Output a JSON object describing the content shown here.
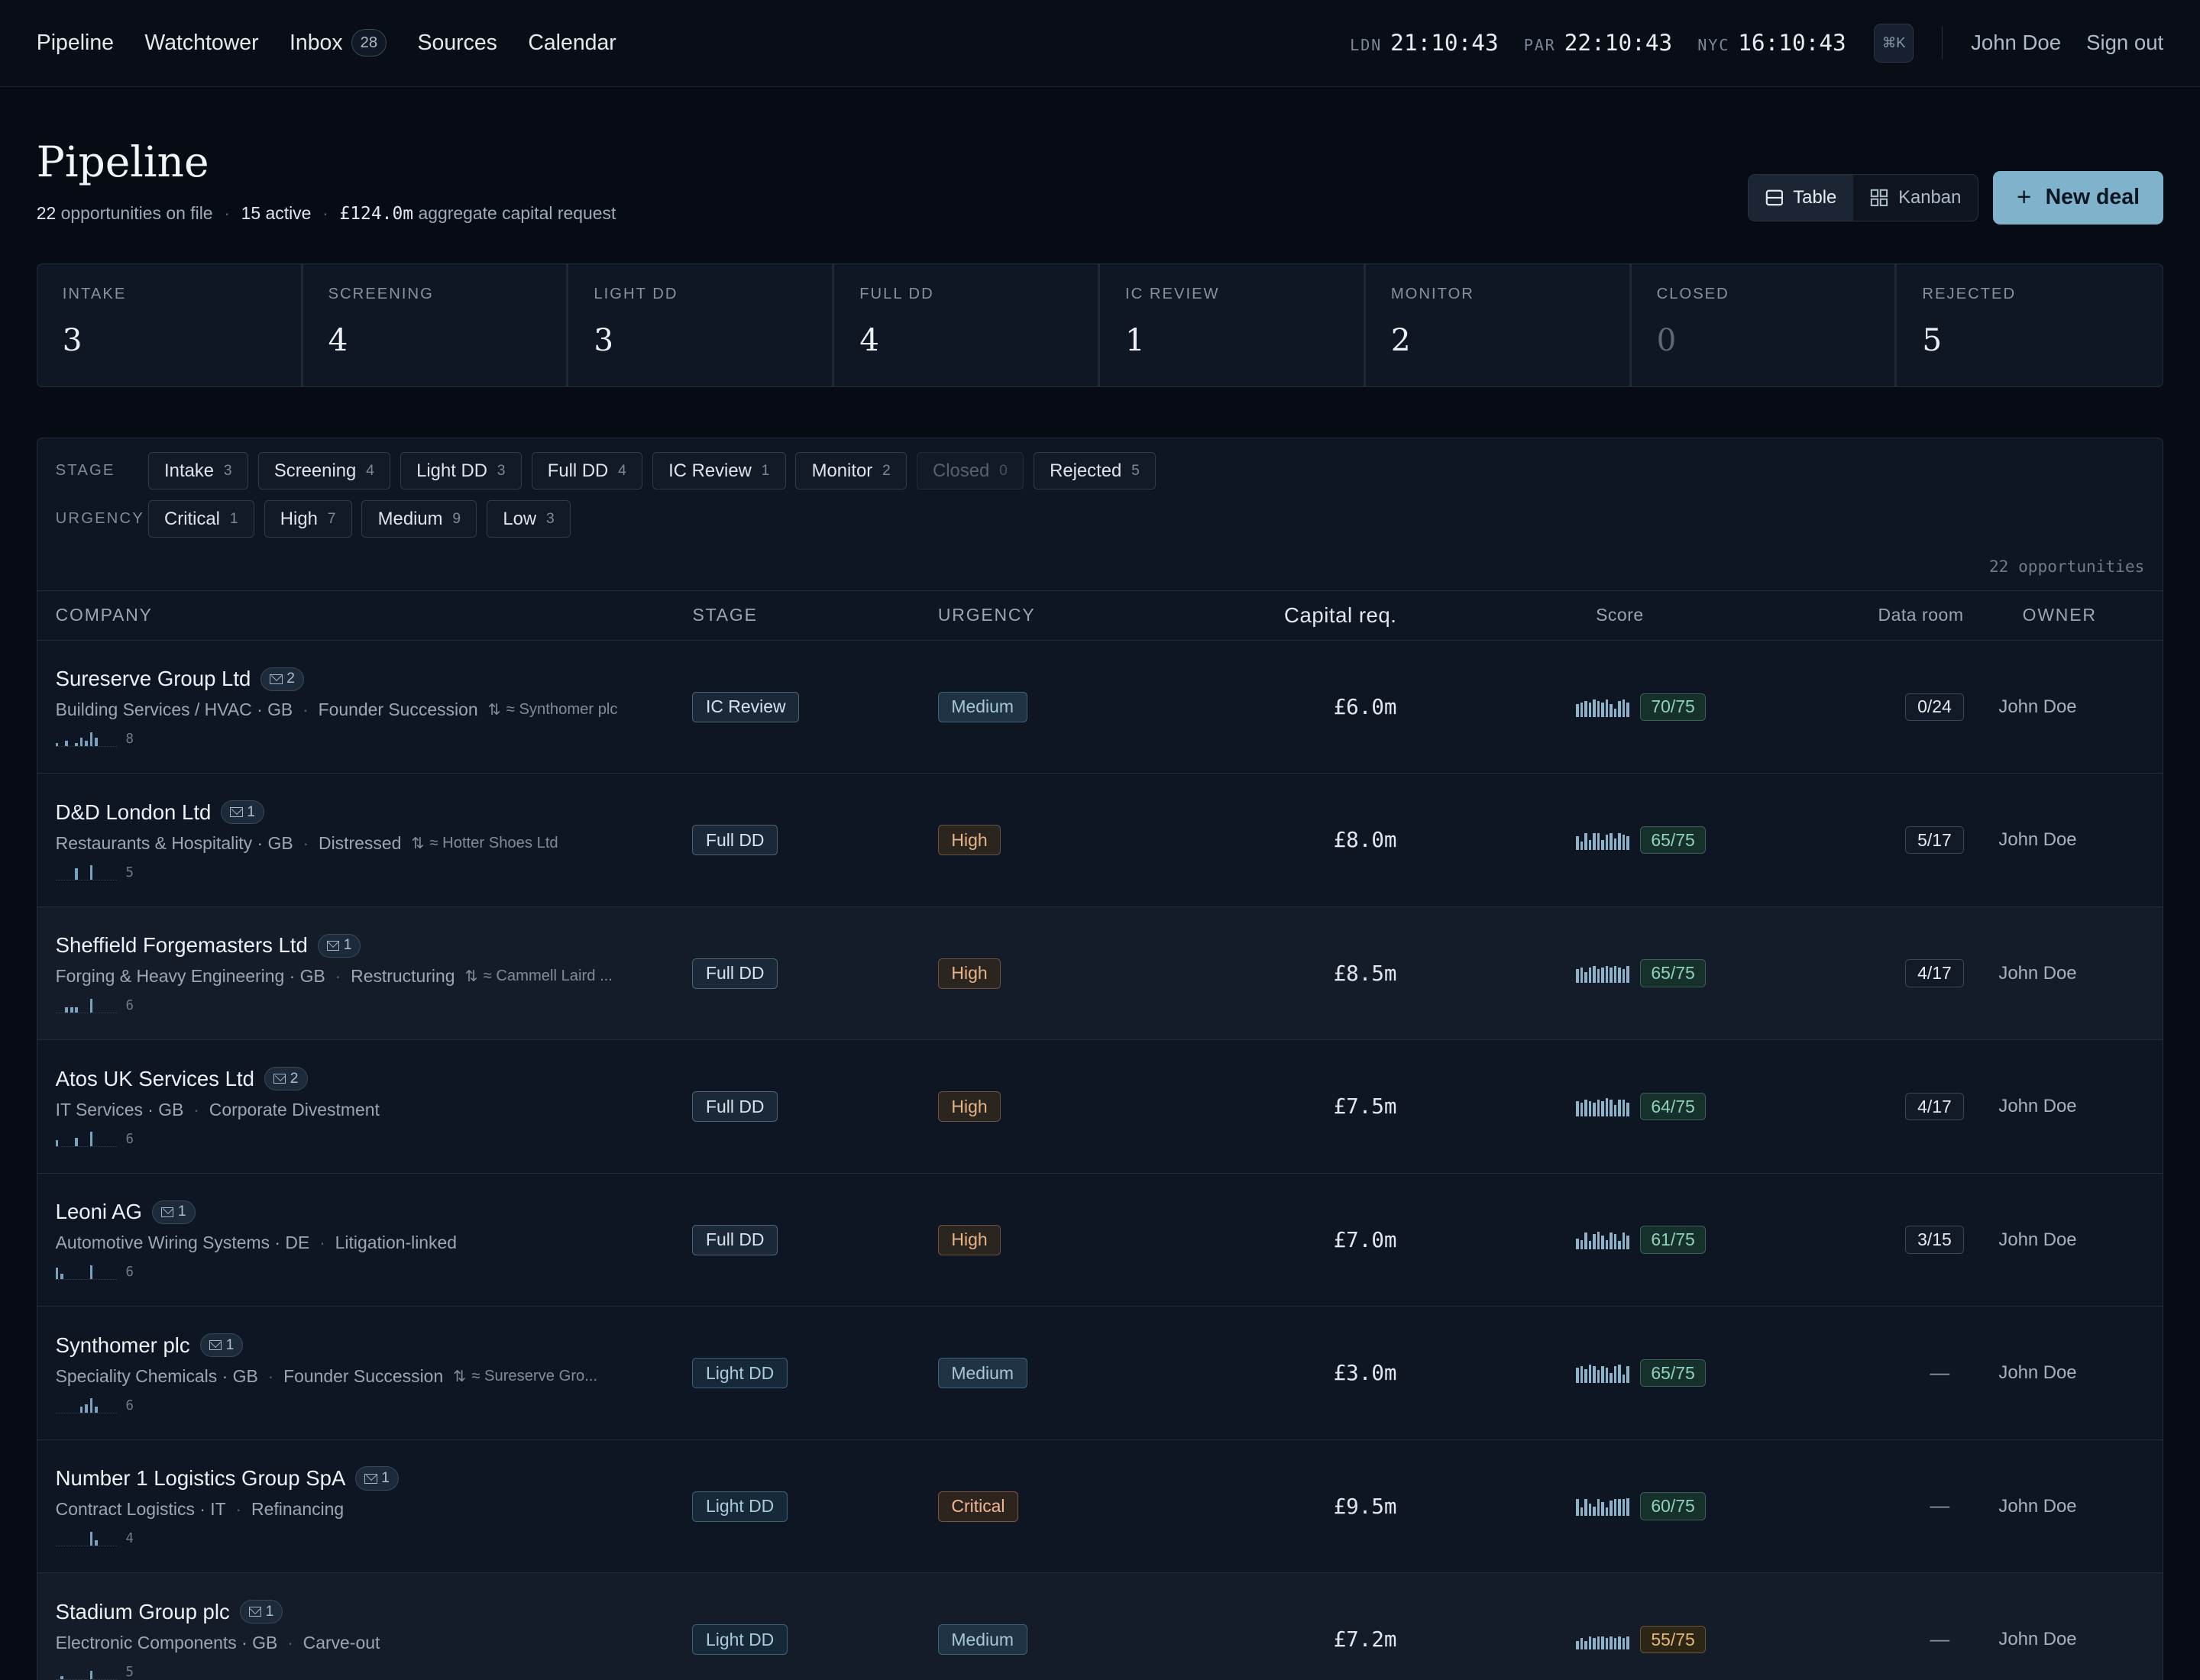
{
  "nav": {
    "links": [
      "Pipeline",
      "Watchtower",
      "Inbox",
      "Sources",
      "Calendar"
    ],
    "inbox_count": "28",
    "clocks": [
      {
        "city": "LDN",
        "time": "21:10:43"
      },
      {
        "city": "PAR",
        "time": "22:10:43"
      },
      {
        "city": "NYC",
        "time": "16:10:43"
      }
    ],
    "shortcut": "⌘K",
    "user": "John Doe",
    "signout": "Sign out"
  },
  "header": {
    "title": "Pipeline",
    "opps_num": "22",
    "opps_text": "opportunities on file",
    "active": "15 active",
    "capital": "£124.0m",
    "capital_text": "aggregate capital request",
    "view_table": "Table",
    "view_kanban": "Kanban",
    "new_deal": "New deal"
  },
  "stages": [
    {
      "label": "INTAKE",
      "value": "3"
    },
    {
      "label": "SCREENING",
      "value": "4"
    },
    {
      "label": "LIGHT DD",
      "value": "3"
    },
    {
      "label": "FULL DD",
      "value": "4"
    },
    {
      "label": "IC REVIEW",
      "value": "1"
    },
    {
      "label": "MONITOR",
      "value": "2"
    },
    {
      "label": "CLOSED",
      "value": "0"
    },
    {
      "label": "REJECTED",
      "value": "5"
    }
  ],
  "filters": {
    "stage_label": "STAGE",
    "urgency_label": "URGENCY",
    "stage_chips": [
      {
        "label": "Intake",
        "count": "3"
      },
      {
        "label": "Screening",
        "count": "4"
      },
      {
        "label": "Light DD",
        "count": "3"
      },
      {
        "label": "Full DD",
        "count": "4"
      },
      {
        "label": "IC Review",
        "count": "1"
      },
      {
        "label": "Monitor",
        "count": "2"
      },
      {
        "label": "Closed",
        "count": "0"
      },
      {
        "label": "Rejected",
        "count": "5"
      }
    ],
    "urgency_chips": [
      {
        "label": "Critical",
        "count": "1"
      },
      {
        "label": "High",
        "count": "7"
      },
      {
        "label": "Medium",
        "count": "9"
      },
      {
        "label": "Low",
        "count": "3"
      }
    ],
    "count_text": "22 opportunities"
  },
  "table": {
    "headers": {
      "company": "COMPANY",
      "stage": "STAGE",
      "urgency": "URGENCY",
      "capital": "Capital req.",
      "score": "Score",
      "data_room": "Data room",
      "owner": "OWNER"
    },
    "rows": [
      {
        "name": "Sureserve Group Ltd",
        "mail": "2",
        "sector": "Building Services / HVAC · GB",
        "situation": "Founder Succession",
        "related": "≈ Synthomer plc",
        "spark": [
          1,
          0,
          2,
          0,
          1,
          3,
          2,
          5,
          3
        ],
        "spark_n": "8",
        "stage": "IC Review",
        "stage_kind": "ic",
        "urgency": "Medium",
        "capital": "£6.0m",
        "score_bars": [
          9,
          10,
          11,
          10,
          12,
          11,
          10,
          12,
          9,
          6,
          11,
          12,
          10
        ],
        "score": "70/75",
        "score_warn": false,
        "data_room": "0/24",
        "owner": "John Doe"
      },
      {
        "name": "D&D London Ltd",
        "mail": "1",
        "sector": "Restaurants & Hospitality · GB",
        "situation": "Distressed",
        "related": "≈ Hotter Shoes Ltd",
        "spark": [
          0,
          0,
          0,
          0,
          4,
          0,
          0,
          5,
          0
        ],
        "spark_n": "5",
        "stage": "Full DD",
        "stage_kind": "full",
        "urgency": "High",
        "capital": "£8.0m",
        "score_bars": [
          10,
          6,
          12,
          7,
          12,
          12,
          7,
          11,
          12,
          8,
          12,
          11,
          10
        ],
        "score": "65/75",
        "score_warn": false,
        "data_room": "5/17",
        "owner": "John Doe"
      },
      {
        "name": "Sheffield Forgemasters Ltd",
        "mail": "1",
        "sector": "Forging & Heavy Engineering · GB",
        "situation": "Restructuring",
        "related": "≈ Cammell Laird ...",
        "spark": [
          0,
          0,
          2,
          2,
          2,
          0,
          0,
          5,
          0
        ],
        "spark_n": "6",
        "stage": "Full DD",
        "stage_kind": "full",
        "urgency": "High",
        "capital": "£8.5m",
        "score_bars": [
          10,
          11,
          8,
          11,
          12,
          10,
          11,
          12,
          11,
          12,
          11,
          10,
          12
        ],
        "score": "65/75",
        "score_warn": false,
        "data_room": "4/17",
        "owner": "John Doe"
      },
      {
        "name": "Atos UK Services Ltd",
        "mail": "2",
        "sector": "IT Services · GB",
        "situation": "Corporate Divestment",
        "related": "",
        "spark": [
          2,
          0,
          0,
          0,
          3,
          0,
          0,
          5,
          0
        ],
        "spark_n": "6",
        "stage": "Full DD",
        "stage_kind": "full",
        "urgency": "High",
        "capital": "£7.5m",
        "score_bars": [
          11,
          10,
          12,
          11,
          10,
          12,
          11,
          13,
          12,
          8,
          12,
          12,
          10
        ],
        "score": "64/75",
        "score_warn": false,
        "data_room": "4/17",
        "owner": "John Doe"
      },
      {
        "name": "Leoni AG",
        "mail": "1",
        "sector": "Automotive Wiring Systems · DE",
        "situation": "Litigation-linked",
        "related": "",
        "spark": [
          4,
          2,
          0,
          0,
          0,
          0,
          0,
          5,
          0
        ],
        "spark_n": "6",
        "stage": "Full DD",
        "stage_kind": "full",
        "urgency": "High",
        "capital": "£7.0m",
        "score_bars": [
          8,
          7,
          12,
          6,
          11,
          13,
          10,
          7,
          12,
          11,
          6,
          12,
          10
        ],
        "score": "61/75",
        "score_warn": false,
        "data_room": "3/15",
        "owner": "John Doe"
      },
      {
        "name": "Synthomer plc",
        "mail": "1",
        "sector": "Speciality Chemicals · GB",
        "situation": "Founder Succession",
        "related": "≈ Sureserve Gro...",
        "spark": [
          0,
          0,
          0,
          0,
          0,
          2,
          3,
          5,
          2
        ],
        "spark_n": "6",
        "stage": "Light DD",
        "stage_kind": "light",
        "urgency": "Medium",
        "capital": "£3.0m",
        "score_bars": [
          11,
          12,
          10,
          13,
          12,
          9,
          12,
          11,
          7,
          12,
          13,
          6,
          12
        ],
        "score": "65/75",
        "score_warn": false,
        "data_room": "",
        "owner": "John Doe"
      },
      {
        "name": "Number 1 Logistics Group SpA",
        "mail": "1",
        "sector": "Contract Logistics · IT",
        "situation": "Refinancing",
        "related": "",
        "spark": [
          0,
          0,
          0,
          0,
          0,
          0,
          0,
          5,
          2
        ],
        "spark_n": "4",
        "stage": "Light DD",
        "stage_kind": "light",
        "urgency": "Critical",
        "capital": "£9.5m",
        "score_bars": [
          12,
          6,
          12,
          9,
          7,
          12,
          10,
          6,
          11,
          12,
          12,
          12,
          13
        ],
        "score": "60/75",
        "score_warn": false,
        "data_room": "",
        "owner": "John Doe"
      },
      {
        "name": "Stadium Group plc",
        "mail": "1",
        "sector": "Electronic Components · GB",
        "situation": "Carve-out",
        "related": "",
        "spark": [
          0,
          1,
          0,
          0,
          0,
          0,
          0,
          3,
          0
        ],
        "spark_n": "5",
        "stage": "Light DD",
        "stage_kind": "light",
        "urgency": "Medium",
        "capital": "£7.2m",
        "score_bars": [
          6,
          8,
          6,
          9,
          8,
          9,
          9,
          8,
          9,
          8,
          9,
          8,
          9
        ],
        "score": "55/75",
        "score_warn": true,
        "data_room": "",
        "owner": "John Doe"
      }
    ]
  }
}
